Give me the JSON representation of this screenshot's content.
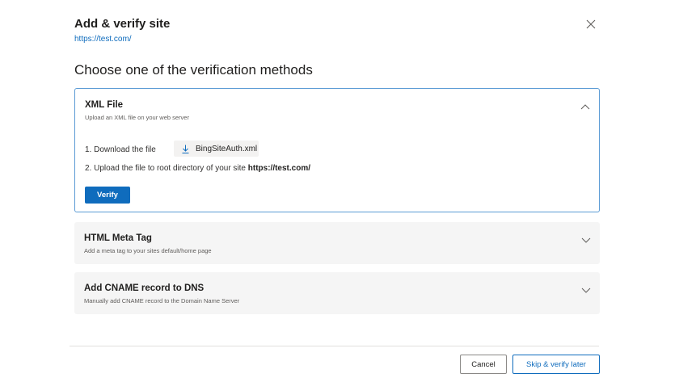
{
  "dialog": {
    "title": "Add & verify site",
    "site_url": "https://test.com/",
    "heading": "Choose one of the verification methods"
  },
  "methods": [
    {
      "title": "XML File",
      "subtitle": "Upload an XML file on your web server",
      "expanded": true,
      "step1": "1. Download the file",
      "download_label": "BingSiteAuth.xml",
      "step2_prefix": "2. Upload the file to root directory of your site ",
      "step2_url": "https://test.com/",
      "verify_label": "Verify"
    },
    {
      "title": "HTML Meta Tag",
      "subtitle": "Add a meta tag to your sites default/home page",
      "expanded": false
    },
    {
      "title": "Add CNAME record to DNS",
      "subtitle": "Manually add CNAME record to the Domain Name Server",
      "expanded": false
    }
  ],
  "footer": {
    "cancel_label": "Cancel",
    "skip_label": "Skip & verify later"
  },
  "icons": {
    "close": "close-icon",
    "expand": "chevron-down-icon",
    "collapse": "chevron-up-icon",
    "download": "download-icon"
  },
  "colors": {
    "accent": "#0f6cbd",
    "panel_border": "#5b9bd5",
    "panel_bg": "#f5f5f5"
  }
}
